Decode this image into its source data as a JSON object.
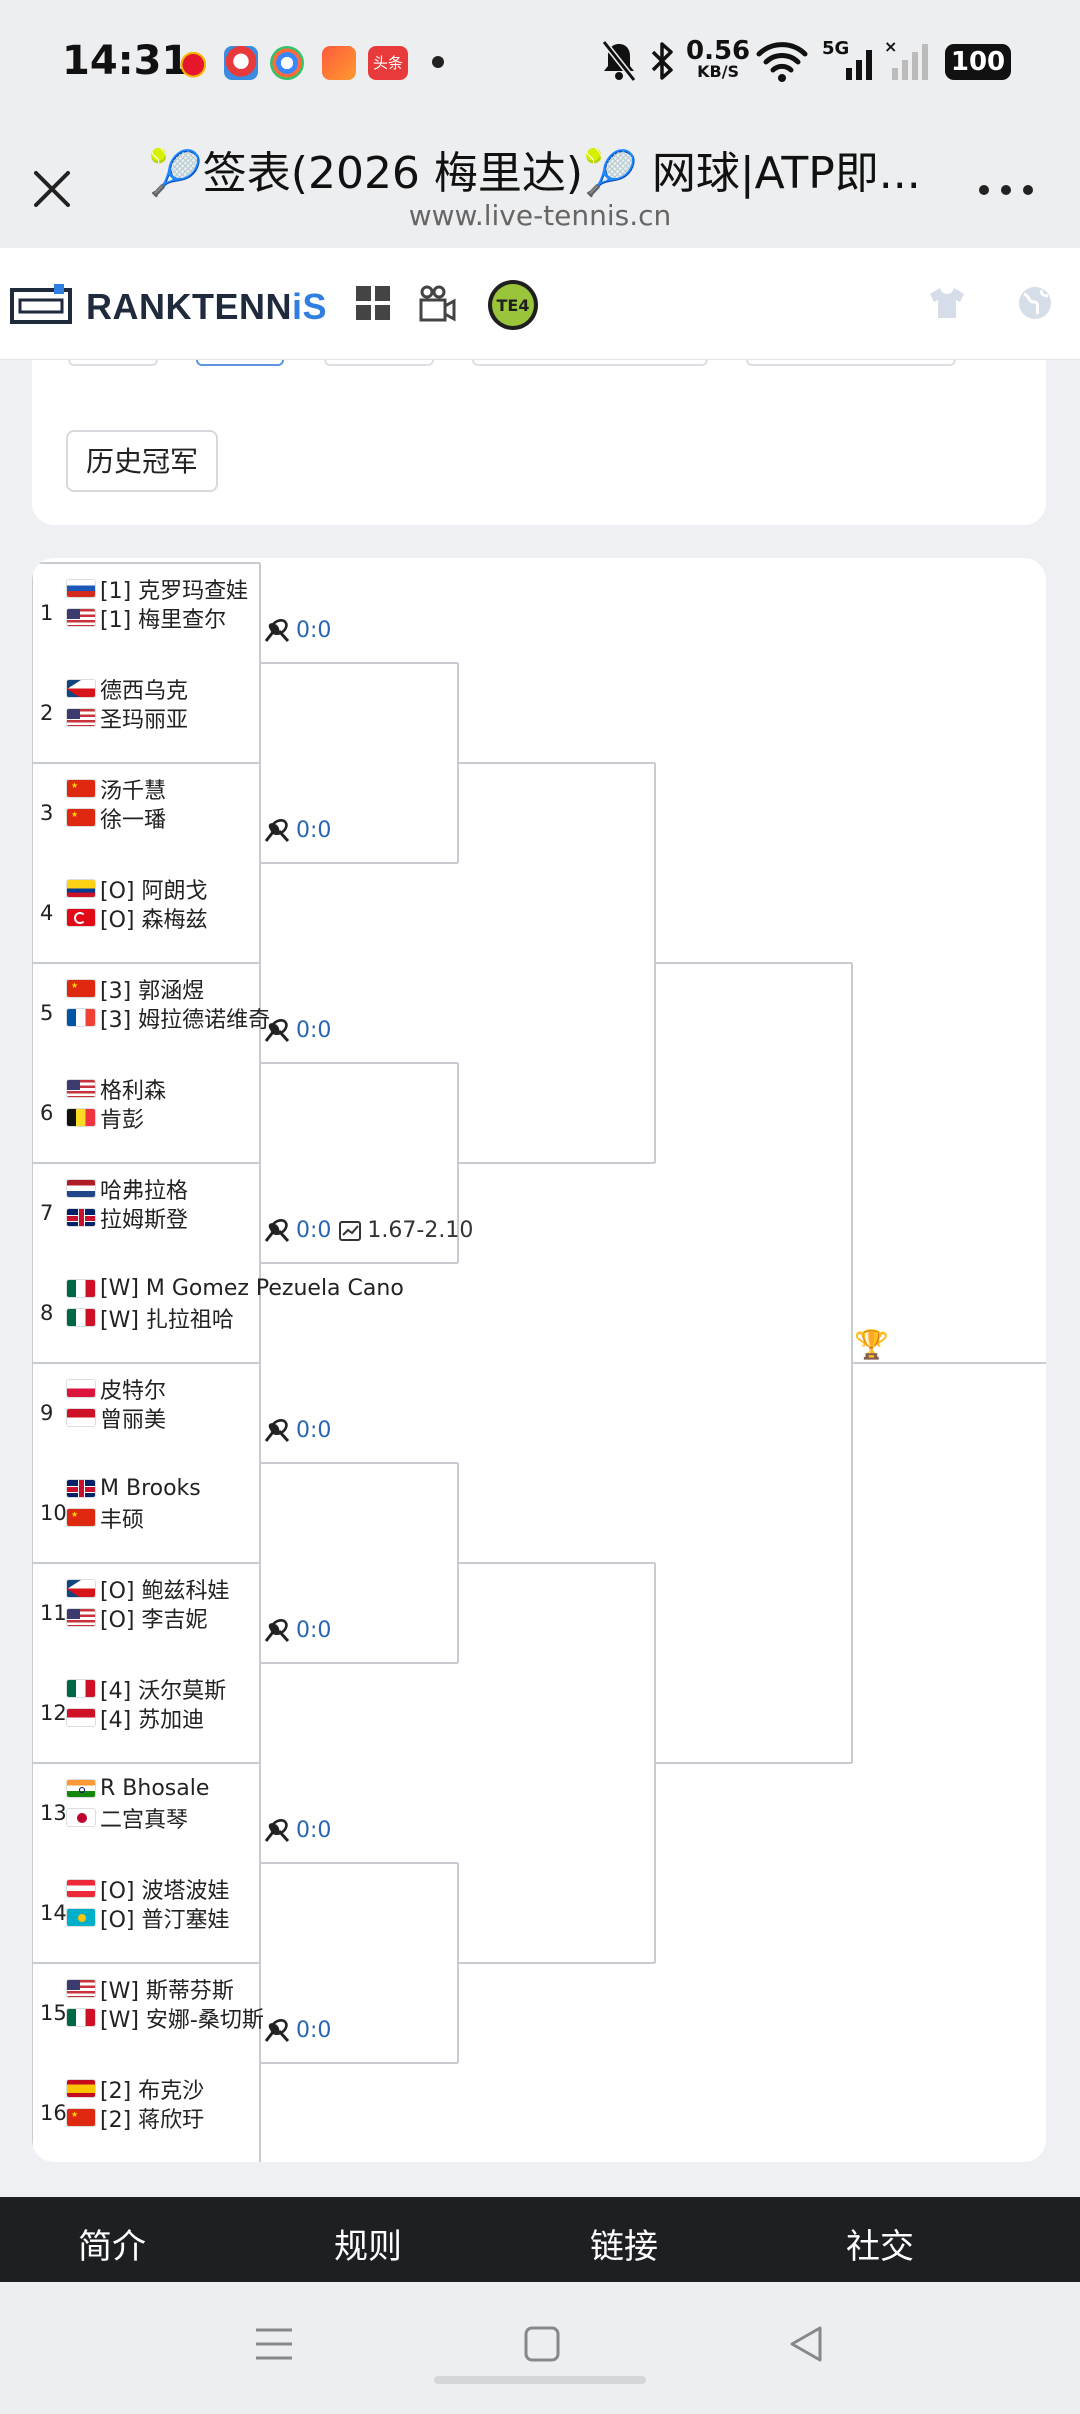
{
  "status_bar": {
    "time": "14:31",
    "apps": [
      "weibo-app",
      "clown-app",
      "browser-app",
      "game-app",
      "toutiao-app"
    ],
    "app_badge": "头条",
    "net_speed_value": "0.56",
    "net_speed_unit": "KB/S",
    "network": "5G",
    "battery": "100"
  },
  "browser": {
    "page_title": "🎾签表(2026 梅里达)🎾 网球|ATP即...",
    "url": "www.live-tennis.cn"
  },
  "site": {
    "logo_part1": "RANKTENN",
    "logo_part2": "iS",
    "te4_label": "TE4",
    "champions_button": "历史冠军"
  },
  "bracket": {
    "matches": [
      {
        "num": "1",
        "players": [
          {
            "flag": "ru",
            "name": "[1] 克罗玛查娃"
          },
          {
            "flag": "us",
            "name": "[1] 梅里查尔"
          }
        ]
      },
      {
        "num": "2",
        "players": [
          {
            "flag": "cz",
            "name": "德西乌克"
          },
          {
            "flag": "us",
            "name": "圣玛丽亚"
          }
        ]
      },
      {
        "num": "3",
        "players": [
          {
            "flag": "cn",
            "name": "汤千慧"
          },
          {
            "flag": "cn",
            "name": "徐一璠"
          }
        ]
      },
      {
        "num": "4",
        "players": [
          {
            "flag": "co",
            "name": "[O] 阿朗戈"
          },
          {
            "flag": "tr",
            "name": "[O] 森梅兹"
          }
        ]
      },
      {
        "num": "5",
        "players": [
          {
            "flag": "cn",
            "name": "[3] 郭涵煜"
          },
          {
            "flag": "fr",
            "name": "[3] 姆拉德诺维奇"
          }
        ]
      },
      {
        "num": "6",
        "players": [
          {
            "flag": "us",
            "name": "格利森"
          },
          {
            "flag": "be",
            "name": "肯彭"
          }
        ]
      },
      {
        "num": "7",
        "players": [
          {
            "flag": "nl",
            "name": "哈弗拉格"
          },
          {
            "flag": "gb",
            "name": "拉姆斯登"
          }
        ]
      },
      {
        "num": "8",
        "players": [
          {
            "flag": "mx",
            "name": "[W] M Gomez Pezuela Cano"
          },
          {
            "flag": "mx",
            "name": "[W] 扎拉祖哈"
          }
        ]
      },
      {
        "num": "9",
        "players": [
          {
            "flag": "pl",
            "name": "皮特尔"
          },
          {
            "flag": "id",
            "name": "曾丽美"
          }
        ]
      },
      {
        "num": "10",
        "players": [
          {
            "flag": "gb",
            "name": "M Brooks"
          },
          {
            "flag": "cn",
            "name": "丰硕"
          }
        ]
      },
      {
        "num": "11",
        "players": [
          {
            "flag": "cz",
            "name": "[O] 鲍兹科娃"
          },
          {
            "flag": "us",
            "name": "[O] 李吉妮"
          }
        ]
      },
      {
        "num": "12",
        "players": [
          {
            "flag": "mx",
            "name": "[4] 沃尔莫斯"
          },
          {
            "flag": "id",
            "name": "[4] 苏加迪"
          }
        ]
      },
      {
        "num": "13",
        "players": [
          {
            "flag": "in",
            "name": "R Bhosale"
          },
          {
            "flag": "jp",
            "name": "二宫真琴"
          }
        ]
      },
      {
        "num": "14",
        "players": [
          {
            "flag": "at",
            "name": "[O] 波塔波娃"
          },
          {
            "flag": "kz",
            "name": "[O] 普汀塞娃"
          }
        ]
      },
      {
        "num": "15",
        "players": [
          {
            "flag": "us",
            "name": "[W] 斯蒂芬斯"
          },
          {
            "flag": "mx",
            "name": "[W] 安娜-桑切斯"
          }
        ]
      },
      {
        "num": "16",
        "players": [
          {
            "flag": "es",
            "name": "[2] 布克沙"
          },
          {
            "flag": "cn",
            "name": "[2] 蒋欣玗"
          }
        ]
      }
    ],
    "scores": [
      {
        "score": "0:0",
        "odds": ""
      },
      {
        "score": "0:0",
        "odds": ""
      },
      {
        "score": "0:0",
        "odds": ""
      },
      {
        "score": "0:0",
        "odds": "1.67-2.10"
      },
      {
        "score": "0:0",
        "odds": ""
      },
      {
        "score": "0:0",
        "odds": ""
      },
      {
        "score": "0:0",
        "odds": ""
      },
      {
        "score": "0:0",
        "odds": ""
      }
    ],
    "trophy": "🏆"
  },
  "footer": {
    "items": [
      "简介",
      "规则",
      "链接",
      "社交"
    ]
  },
  "colors": {
    "score_blue": "#2a65b3",
    "logo_dark": "#1f2b3d",
    "logo_blue": "#2f7fe0",
    "te4_green": "#9ac43a",
    "footer_bg": "#1d1f23"
  }
}
